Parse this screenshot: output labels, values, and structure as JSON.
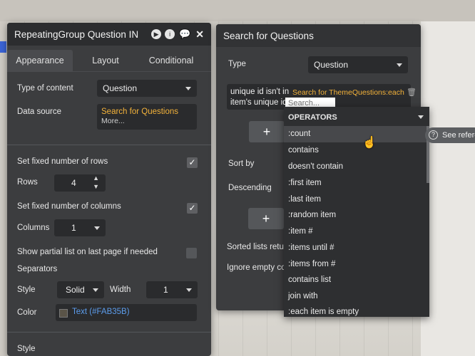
{
  "colors": {
    "panel": "#3c3d3f",
    "header": "#2c2d2f",
    "accent_yellow": "#f3b23a",
    "link_blue": "#5c9ded",
    "swatch": "#FAB35B"
  },
  "left_panel": {
    "title": "RepeatingGroup Question IN",
    "header_icons": [
      "play-icon",
      "info-icon",
      "comment-icon",
      "close-icon"
    ],
    "tabs": [
      "Appearance",
      "Layout",
      "Conditional"
    ],
    "type_of_content": {
      "label": "Type of content",
      "value": "Question"
    },
    "data_source": {
      "label": "Data source",
      "value": "Search for Questions",
      "more": "More..."
    },
    "fixed_rows": {
      "label": "Set fixed number of rows",
      "checked": true
    },
    "rows": {
      "label": "Rows",
      "value": "4"
    },
    "fixed_columns": {
      "label": "Set fixed number of columns",
      "checked": true
    },
    "columns": {
      "label": "Columns",
      "value": "1"
    },
    "partial_list": {
      "label": "Show partial list on last page if needed",
      "checked": false
    },
    "separators": {
      "label": "Separators"
    },
    "style": {
      "label": "Style",
      "value": "Solid",
      "width_label": "Width",
      "width_value": "1"
    },
    "color": {
      "label": "Color",
      "value": "Text (#FAB35B)"
    },
    "style2": {
      "label": "Style"
    }
  },
  "right_panel": {
    "title": "Search for Questions",
    "type": {
      "label": "Type",
      "value": "Question"
    },
    "constraint": {
      "line1": "unique id isn't in",
      "line2": "item's unique id",
      "expression": "Search for ThemeQuestions:each",
      "search_placeholder": "Search..."
    },
    "add_constraint": "+",
    "sort_by": {
      "label": "Sort by"
    },
    "descending": {
      "label": "Descending"
    },
    "add_sort": "+",
    "sorted_lists": {
      "label": "Sorted lists retur"
    },
    "ignore_empty": {
      "label": "Ignore empty co"
    }
  },
  "operators": {
    "header": "OPERATORS",
    "items": [
      ":count",
      "contains",
      "doesn't contain",
      ":first item",
      ":last item",
      ":random item",
      ":item #",
      ":items until #",
      ":items from #",
      "contains list",
      "join with",
      ":each item is empty"
    ],
    "highlighted": ":count"
  },
  "tooltip": {
    "text": "See refere"
  }
}
